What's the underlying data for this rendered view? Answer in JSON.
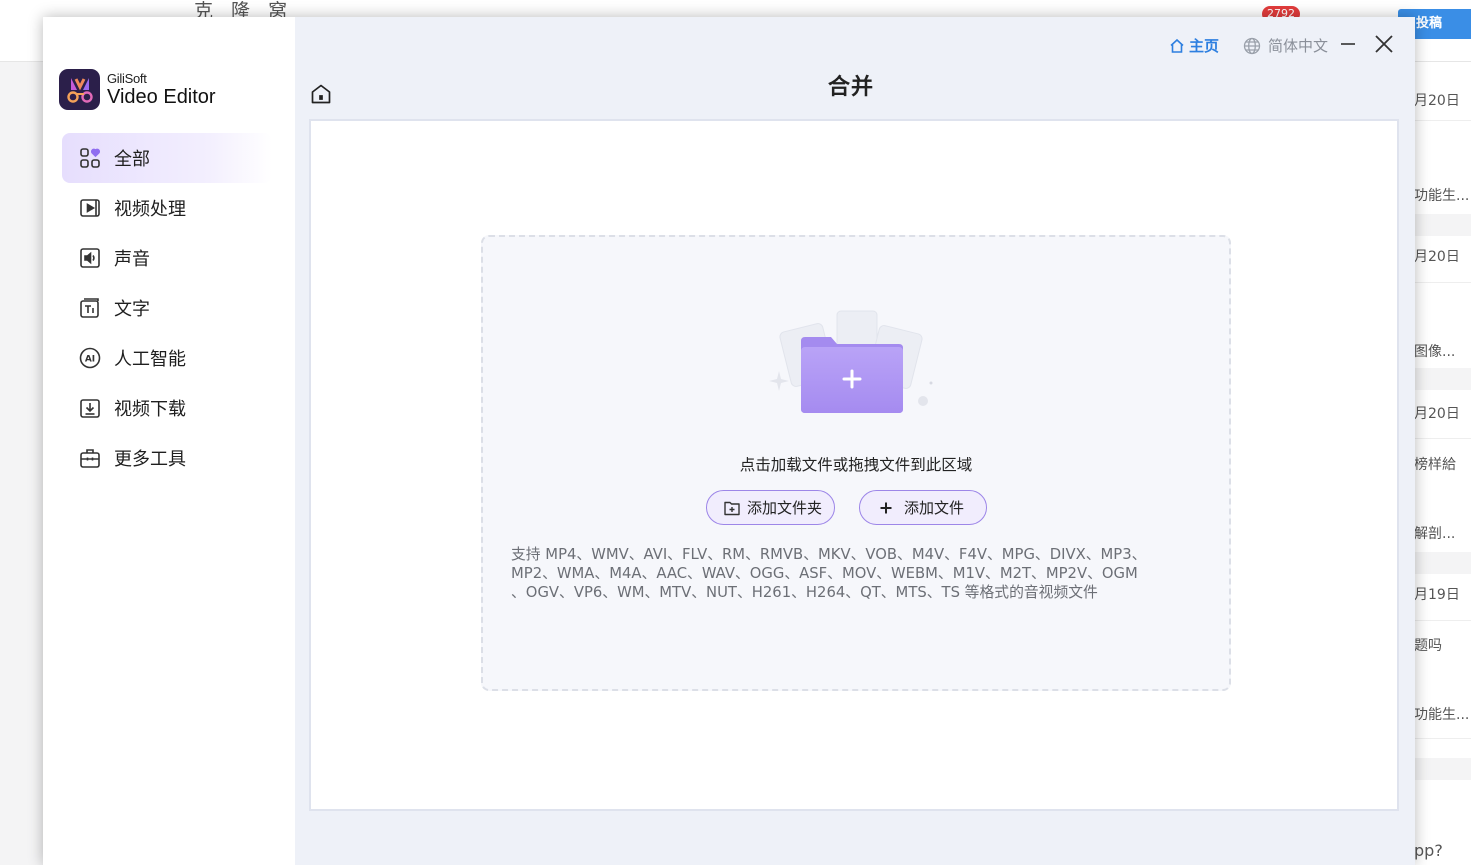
{
  "background": {
    "site_logo": "克 隆 窝",
    "notif_count": "2792",
    "post_button": "投稿",
    "feed": [
      {
        "text": "月20日"
      },
      {
        "text": "功能生..."
      },
      {
        "text": "月20日"
      },
      {
        "text": "图像..."
      },
      {
        "text": "月20日"
      },
      {
        "text": "榜样給"
      },
      {
        "text": "解剖..."
      },
      {
        "text": "月19日"
      },
      {
        "text": "题吗"
      },
      {
        "text": "功能生..."
      },
      {
        "text": "pp?"
      }
    ]
  },
  "app": {
    "brand": {
      "company": "GiliSoft",
      "product": "Video Editor"
    },
    "sidebar": {
      "items": [
        {
          "label": "全部",
          "icon": "grid-heart-icon",
          "active": true
        },
        {
          "label": "视频处理",
          "icon": "video-play-icon"
        },
        {
          "label": "声音",
          "icon": "speaker-icon"
        },
        {
          "label": "文字",
          "icon": "text-icon"
        },
        {
          "label": "人工智能",
          "icon": "ai-icon"
        },
        {
          "label": "视频下载",
          "icon": "download-icon"
        },
        {
          "label": "更多工具",
          "icon": "toolbox-icon"
        }
      ]
    },
    "header": {
      "home_label": "主页",
      "language_label": "简体中文",
      "page_title": "合并"
    },
    "dropzone": {
      "hint": "点击加载文件或拖拽文件到此区域",
      "add_folder_label": "添加文件夹",
      "add_file_label": "添加文件",
      "formats_line1": "支持 MP4、WMV、AVI、FLV、RM、RMVB、MKV、VOB、M4V、F4V、MPG、DIVX、MP3、",
      "formats_line2": "MP2、WMA、M4A、AAC、WAV、OGG、ASF、MOV、WEBM、M1V、M2T、MP2V、OGM",
      "formats_line3": "、OGV、VP6、WM、MTV、NUT、H261、H264、QT、MTS、TS 等格式的音视频文件"
    },
    "colors": {
      "accent": "#9d86e8",
      "link": "#2d7fe0",
      "active_nav": "#e6defd"
    }
  }
}
